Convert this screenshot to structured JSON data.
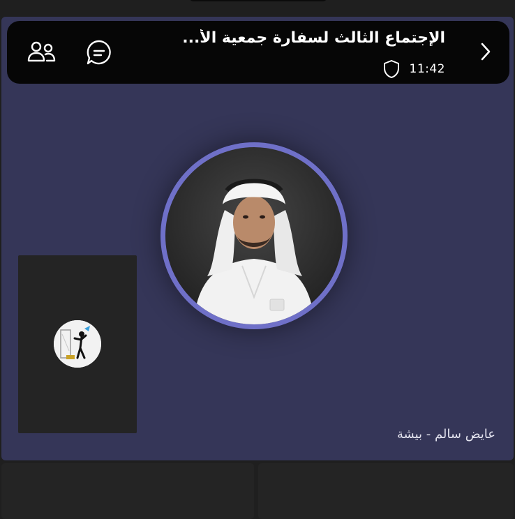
{
  "call": {
    "title": "الإجتماع الثالث لسفارة جمعية الأ...",
    "time": "11:42"
  },
  "header": {
    "back_icon": "chevron-right-icon",
    "chat_icon": "chat-bubble-icon",
    "people_icon": "people-icon",
    "shield_icon": "shield-icon"
  },
  "active_speaker": {
    "name": "عايض سالم - بيشة",
    "ring_color": "#6f70c8"
  },
  "colors": {
    "stage_background": "#353658",
    "header_background": "#060606",
    "tile_background": "#242424"
  }
}
